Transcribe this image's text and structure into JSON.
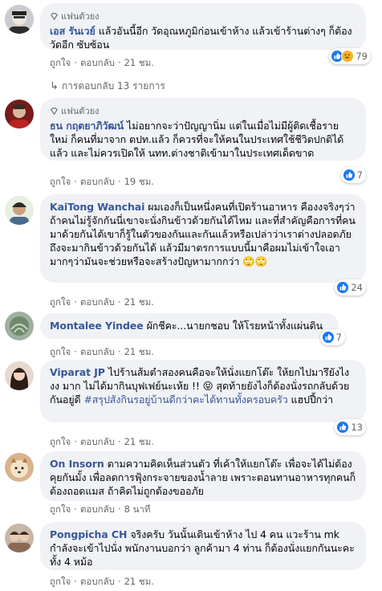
{
  "c1": {
    "badge": "แฟนตัวยง",
    "author": "เอส รันเวย์",
    "text": "แล้วอันนี้อีก วัดอุณหภูมิก่อนเข้าห้าง แล้วเข้าร้านต่างๆ ก็ต้องวัดอีก ซับซ้อน",
    "like": "ถูกใจ",
    "reply": "ตอบกลับ",
    "time": "21 ชม.",
    "reactions": "79"
  },
  "replies_link": "การตอบกลับ 13 รายการ",
  "c2": {
    "badge": "แฟนตัวยง",
    "author": "ธน กฤตยาภิวัฒน์",
    "text": "ไม่อยากจะว่าปัญญานิ่ม แต่ในเมื่อไม่มีผู้ติดเชื้อรายใหม่ ก็คนที่มาจาก ตปท.แล้ว ก็ควรที่จะให้คนในประเทศใช้ชีวิตปกติได้แล้ว และไม่ควรเปิดให้ นทท.ต่างชาติเข้ามาในประเทศเด็ดขาด",
    "like": "ถูกใจ",
    "reply": "ตอบกลับ",
    "time": "19 ชม.",
    "reactions": "7"
  },
  "c3": {
    "author": "KaiTong Wanchai",
    "text": "ผมเองก็เป็นหนึ่งคนที่เปิดร้านอาหาร คืองงจริงๆว่าถ้าคนไม่รู้จักกันนี่เขาจะนั่งกินข้าวด้วยกันได้ไหม และที่สำคัญคือการที่คนมาด้วยกันได้เขาก็รู้ในตัวของกันและกันแล้วหรือเปล่าว่าเราต่างปลอดภัยถึงจะมากินข้าวด้วยกันได้ แล้วมีมาตรการแบบนี้มาคือผมไม่เข้าใจเอามากๆว่ามันจะช่วยหรือจะสร้างปัญหามากกว่า 🙄🙄",
    "like": "ถูกใจ",
    "reply": "ตอบกลับ",
    "time": "21 ชม.",
    "reactions": "24"
  },
  "c4": {
    "author": "Montalee Yindee",
    "text": "ผักชีคะ...นายกชอบ ให้โรยหน้าทั้งแผ่นดิน",
    "like": "ถูกใจ",
    "reply": "ตอบกลับ",
    "time": "21 ชม.",
    "reactions": "7"
  },
  "c5": {
    "author": "Viparat JP",
    "text_a": "ไปร้านส้มตำสองคนคือจะให้นั่งแยกโต๊ะ ให้ยกไปมารึยังไง งง มาก ไม่ได้มากินบุฟเฟย์นะเห้ย !! 😝 สุดท้ายยังไงก็ต้องนั่งรถกลับด้วยกันอยู่ดี ",
    "hashtag": "#สรุปสังกินรอยู่บ้านดีกว่าคะได้ทานทั้งครอบครัว",
    "text_b": " แฮปปี้กว่า",
    "like": "ถูกใจ",
    "reply": "ตอบกลับ",
    "time": "21 ชม.",
    "reactions": "13"
  },
  "c6": {
    "author": "On Insorn",
    "text": "ตามความคิดเห็นส่วนตัว ที่เค้าให้แยกโต๊ะ เพื่อจะได้ไม่ต้องคุยกันมั้ง เพื่อลดการฟุ้งกระจายของน้ำลาย เพราะตอนทานอาหารทุกคนก็ต้องถอดแมส ถ้าคิดไม่ถูกต้องขออภัย",
    "like": "ถูกใจ",
    "reply": "ตอบกลับ",
    "time": "8 นาที"
  },
  "c7": {
    "author": "Pongpicha CH",
    "text": "จริงครับ วันนั้นเดินเข้าห้าง ไป 4 คน แวะร้าน mk กำลังจะเข้าไปนั่ง พนักงานบอกว่า ลูกค้ามา 4 ท่าน ก็ต้องนั่งแยกกันนะคะ ทั้ง 4 หม้อ",
    "like": "ถูกใจ",
    "reply": "ตอบกลับ",
    "time": "21 ชม."
  },
  "colors": {
    "link": "#385898",
    "bubble": "#f0f2f5",
    "meta": "#65676b",
    "like": "#1877f2",
    "haha": "#f7b125"
  }
}
